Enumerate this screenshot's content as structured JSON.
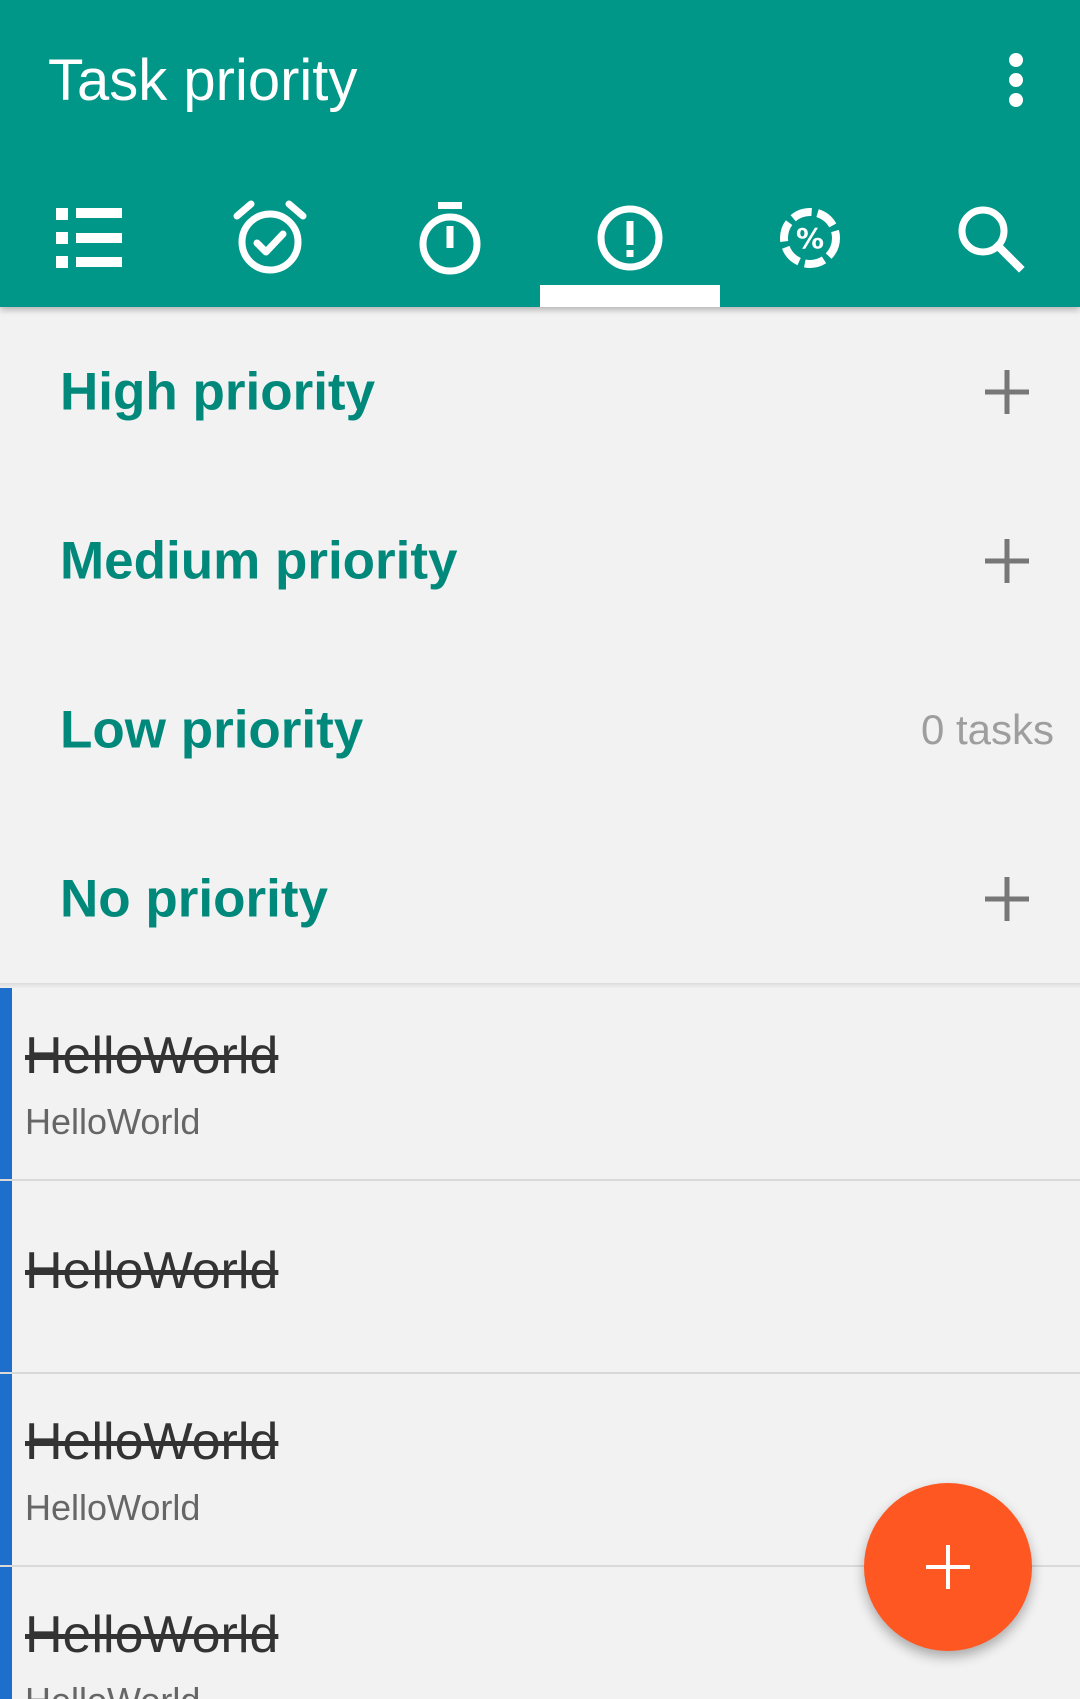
{
  "colors": {
    "primary": "#009688",
    "accent_text": "#00897b",
    "fab": "#ff5722",
    "task_indicator": "#1e6fcc",
    "background": "#f2f2f2"
  },
  "appbar": {
    "title": "Task priority",
    "overflow_icon": "more-vert-icon"
  },
  "tabs": [
    {
      "icon": "list-icon",
      "selected": false
    },
    {
      "icon": "alarm-check-icon",
      "selected": false
    },
    {
      "icon": "timer-icon",
      "selected": false
    },
    {
      "icon": "priority-alert-icon",
      "selected": true
    },
    {
      "icon": "progress-percent-icon",
      "selected": false
    },
    {
      "icon": "search-icon",
      "selected": false
    }
  ],
  "sections": [
    {
      "label": "High priority",
      "trailing": "add",
      "count": ""
    },
    {
      "label": "Medium priority",
      "trailing": "add",
      "count": ""
    },
    {
      "label": "Low priority",
      "trailing": "count",
      "count": "0 tasks"
    },
    {
      "label": "No priority",
      "trailing": "add",
      "count": ""
    }
  ],
  "tasks": [
    {
      "title": "HelloWorld",
      "subtitle": "HelloWorld",
      "completed": true
    },
    {
      "title": "HelloWorld",
      "subtitle": "",
      "completed": true
    },
    {
      "title": "HelloWorld",
      "subtitle": "HelloWorld",
      "completed": true
    },
    {
      "title": "HelloWorld",
      "subtitle": "HelloWorld",
      "completed": true
    }
  ],
  "fab": {
    "icon": "plus-icon"
  }
}
